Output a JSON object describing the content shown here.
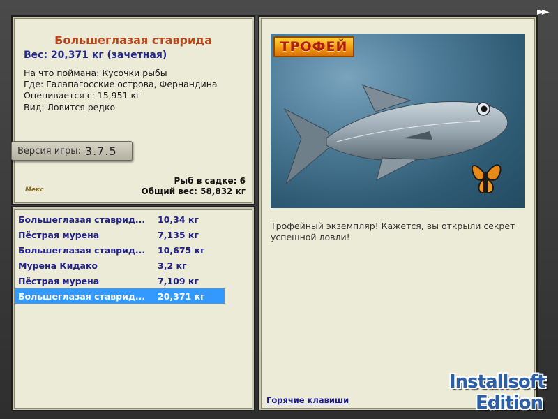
{
  "nav": {
    "forward_symbol": "►►"
  },
  "info": {
    "fish_name": "Большеглазая ставрида",
    "weight_line": "Вес: 20,371 кг (зачетная)",
    "bait_line": "На что поймана: Кусочки рыбы",
    "location_line": "Где: Галапагосские острова, Фернандина",
    "rated_line": "Оценивается с: 15,951 кг",
    "kind_line": "Вид: Ловится редко",
    "version_label": "Версия игры:",
    "version_value": "3.7.5",
    "logo_text": "Мекс",
    "cage_count_line": "Рыб в садке: 6",
    "total_weight_line": "Общий вес: 58,832 кг"
  },
  "catches": [
    {
      "name": "Большеглазая ставрид...",
      "weight": "10,34 кг",
      "selected": false
    },
    {
      "name": "Пёстрая мурена",
      "weight": "7,135 кг",
      "selected": false
    },
    {
      "name": "Большеглазая ставрид...",
      "weight": "10,675 кг",
      "selected": false
    },
    {
      "name": "Мурена Кидако",
      "weight": "3,2 кг",
      "selected": false
    },
    {
      "name": "Пёстрая мурена",
      "weight": "7,109 кг",
      "selected": false
    },
    {
      "name": "Большеглазая ставрид...",
      "weight": "20,371 кг",
      "selected": true
    }
  ],
  "trophy": {
    "badge": "ТРОФЕЙ",
    "description": "Трофейный экземпляр! Кажется, вы открыли секрет успешной ловли!",
    "hotkeys_link": "Горячие клавиши"
  },
  "watermark": {
    "line1": "Installsoft",
    "line2": "Edition"
  },
  "colors": {
    "title": "#b8461b",
    "weight": "#22288c",
    "list_text": "#20218a",
    "selection": "#3399ff",
    "panel_bg": "#ecebd8",
    "badge": "#f19d12"
  }
}
